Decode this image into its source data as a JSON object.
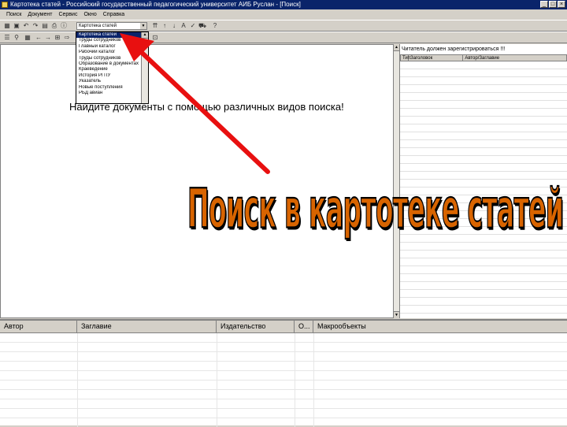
{
  "window": {
    "title": "Картотека статей - Российский государственный педагогический университет АИБ Руслан - [Поиск]",
    "min": "_",
    "max": "□",
    "close": "×"
  },
  "menu": [
    "Поиск",
    "Документ",
    "Сервис",
    "Окно",
    "Справка"
  ],
  "toolbar": {
    "combo_value": "Картотека статей"
  },
  "dropdown": {
    "items": [
      "Картотека статей",
      "Труды сотрудников",
      "Главный каталог",
      "Рабочий каталог",
      "Труды сотрудников",
      "Образование в документах",
      "Краеведение",
      "История РГПУ",
      "Указатель",
      "Новые поступления",
      "РБД авиан"
    ]
  },
  "main": {
    "headline": "Найдите документы с помощью различных видов поиска!"
  },
  "right_panel": {
    "title": "Читатель должен зарегистрироваться !!!",
    "columns": [
      "Тип",
      "Заголовок",
      "Автор/Заглавие"
    ]
  },
  "results": {
    "columns": [
      "Автор",
      "Заглавие",
      "Издательство",
      "О...",
      "Макрообъекты"
    ]
  },
  "overlay": {
    "caption": "Поиск в картотеке статей",
    "caption_color": "#d86400",
    "arrow_color": "#e81010"
  }
}
